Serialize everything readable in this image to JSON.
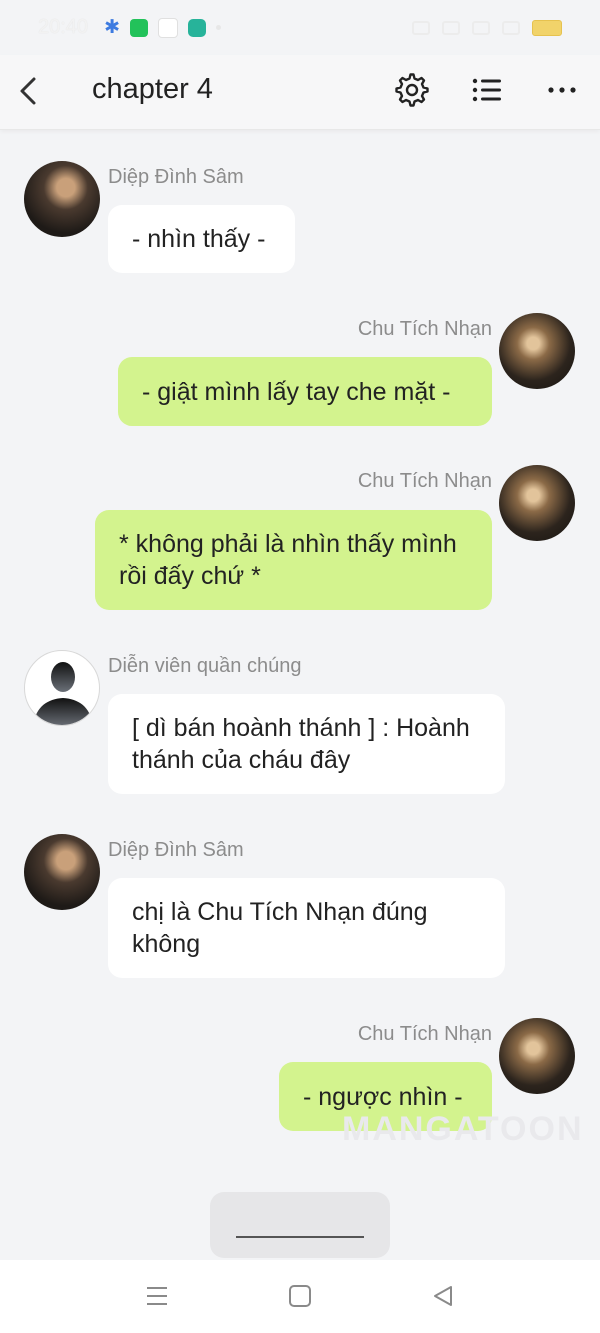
{
  "status_bar": {
    "time": "20:40"
  },
  "app_bar": {
    "title": "chapter 4",
    "back_icon": "chevron-left-icon",
    "settings_icon": "gear-icon",
    "list_icon": "list-icon",
    "more_icon": "more-horizontal-icon"
  },
  "messages": [
    {
      "speaker": "Diệp Đình Sâm",
      "side": "left",
      "text": "- nhìn thấy -"
    },
    {
      "speaker": "Chu Tích Nhạn",
      "side": "right",
      "text": "- giật mình lấy tay che mặt -"
    },
    {
      "speaker": "Chu Tích Nhạn",
      "side": "right",
      "text": "* không phải là nhìn thấy mình rồi đấy chứ *"
    },
    {
      "speaker": "Diễn viên quần chúng",
      "side": "left",
      "text": "[ dì bán hoành thánh ] : Hoành thánh của cháu đây"
    },
    {
      "speaker": "Diệp Đình Sâm",
      "side": "left",
      "text": "chị là Chu Tích Nhạn đúng không"
    },
    {
      "speaker": "Chu Tích Nhạn",
      "side": "right",
      "text": "- ngược nhìn -"
    }
  ],
  "watermark": "MANGATOON",
  "colors": {
    "bubble_right": "#d3f38e",
    "bubble_left": "#ffffff",
    "background": "#f3f4f6"
  },
  "nav_icons": [
    "menu-icon",
    "home-square-icon",
    "back-triangle-icon"
  ]
}
